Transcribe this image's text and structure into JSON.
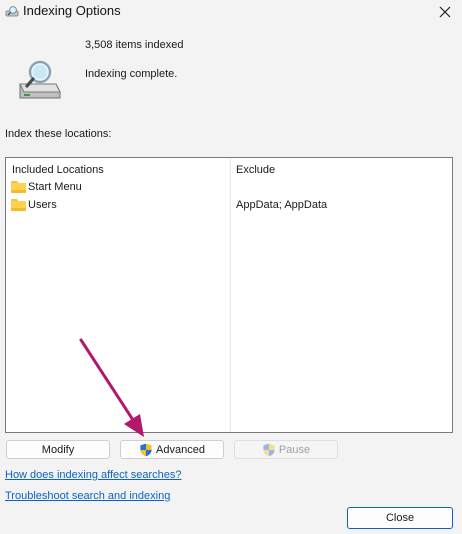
{
  "window": {
    "title": "Indexing Options"
  },
  "summary": {
    "items_indexed": "3,508 items indexed",
    "status": "Indexing complete."
  },
  "locations": {
    "label": "Index these locations:",
    "columns": {
      "included": "Included Locations",
      "exclude": "Exclude"
    },
    "rows": [
      {
        "name": "Start Menu",
        "exclude": ""
      },
      {
        "name": "Users",
        "exclude": "AppData; AppData"
      }
    ]
  },
  "buttons": {
    "modify": "Modify",
    "advanced": "Advanced",
    "pause": "Pause",
    "close": "Close"
  },
  "links": {
    "how_affects": "How does indexing affect searches?",
    "troubleshoot": "Troubleshoot search and indexing"
  },
  "icons": {
    "window": "indexing-icon",
    "status": "drive-magnifier-icon",
    "folder": "folder-icon",
    "shield": "uac-shield-icon",
    "close": "close-icon",
    "annotation": "arrow-annotation"
  },
  "colors": {
    "accent": "#0a63c4",
    "annotation_arrow": "#b3186c",
    "folder": "#ffd24d"
  }
}
